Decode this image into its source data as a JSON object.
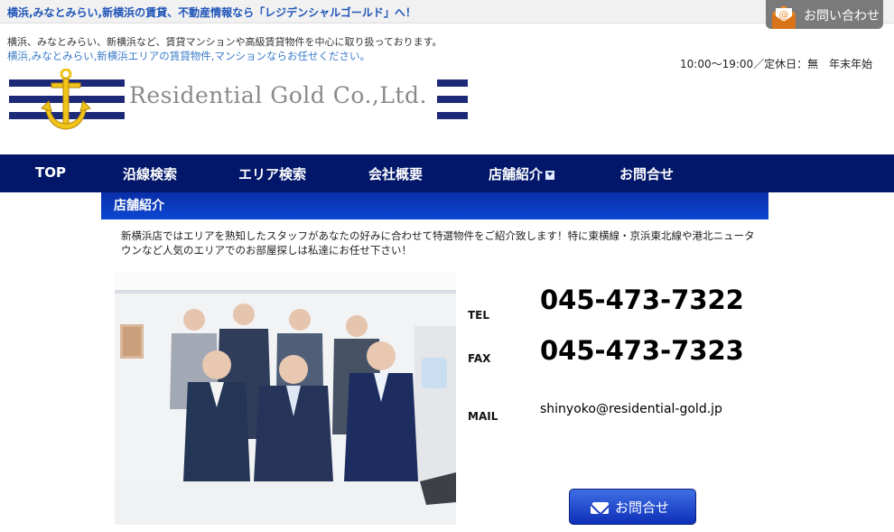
{
  "header": {
    "tagline": "横浜,みなとみらい,新横浜の賃貸、不動産情報なら「レジデンシャルゴールド」へ！",
    "contact_tab_label": "お問い合わせ",
    "intro_line1": "横浜、みなとみらい、新横浜など、賃貸マンションや高級賃貸物件を中心に取り扱っております。",
    "intro_line2": "横浜,みなとみらい,新横浜エリアの賃貸物件,マンションならお任せください。",
    "hours": "10:00〜19:00／定休日：無　年末年始",
    "logo_text": "Residential Gold Co.,Ltd."
  },
  "nav": {
    "items": [
      {
        "label": "TOP"
      },
      {
        "label": "沿線検索"
      },
      {
        "label": "エリア検索"
      },
      {
        "label": "会社概要"
      },
      {
        "label": "店舗紹介"
      },
      {
        "label": "お問合せ"
      }
    ]
  },
  "section": {
    "title": "店舗紹介",
    "description": "新横浜店ではエリアを熟知したスタッフがあなたの好みに合わせて特選物件をご紹介致します！特に東横線・京浜東北線や港北ニュータウンなど人気のエリアでのお部屋探しは私達にお任せ下さい！"
  },
  "contact": {
    "tel_label": "TEL",
    "tel": "045-473-7322",
    "fax_label": "FAX",
    "fax": "045-473-7323",
    "mail_label": "MAIL",
    "mail": "shinyoko@residential-gold.jp",
    "button_label": "お問合せ"
  },
  "colors": {
    "nav_bg": "#02176a",
    "accent_blue": "#1f55b8",
    "section_header": "#0b3cc4"
  },
  "icons": {
    "contact_tab": "mail-icon",
    "nav_dropdown": "chevron-down-icon",
    "contact_button": "envelope-icon",
    "logo": "anchor-icon"
  }
}
